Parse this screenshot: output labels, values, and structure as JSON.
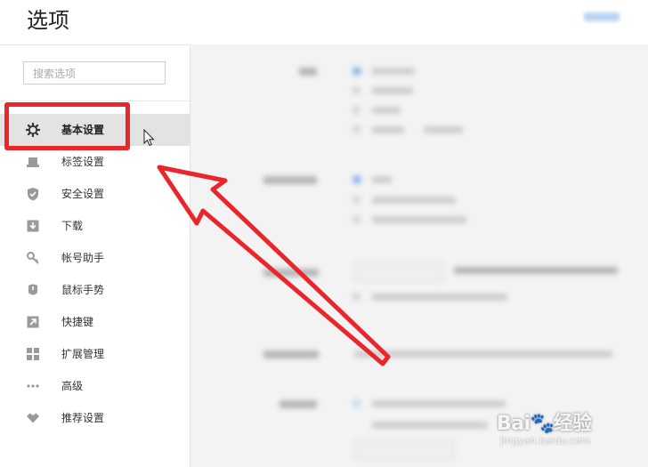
{
  "app": {
    "title": "选项"
  },
  "search": {
    "placeholder": "搜索选项",
    "value": ""
  },
  "sidebar": {
    "items": [
      {
        "label": "基本设置",
        "icon": "gear-icon",
        "active": true
      },
      {
        "label": "标签设置",
        "icon": "tab-icon",
        "active": false
      },
      {
        "label": "安全设置",
        "icon": "shield-check-icon",
        "active": false
      },
      {
        "label": "下载",
        "icon": "download-icon",
        "active": false
      },
      {
        "label": "帐号助手",
        "icon": "key-icon",
        "active": false
      },
      {
        "label": "鼠标手势",
        "icon": "mouse-icon",
        "active": false
      },
      {
        "label": "快捷键",
        "icon": "shortcut-arrow-icon",
        "active": false
      },
      {
        "label": "扩展管理",
        "icon": "grid-icon",
        "active": false
      },
      {
        "label": "高级",
        "icon": "more-dots-icon",
        "active": false
      },
      {
        "label": "推荐设置",
        "icon": "heart-icon",
        "active": false
      }
    ]
  },
  "annotation": {
    "highlight_color": "#e8262b",
    "arrow_color": "#e8262b"
  },
  "watermark": {
    "brand": "Bai",
    "brand_suffix": "经验",
    "url": "jingyan.baidu.com"
  },
  "colors": {
    "sidebar_active_bg": "#e3e3e3",
    "content_bg": "#f3f3f3",
    "radio_accent": "#8bb6ea"
  }
}
